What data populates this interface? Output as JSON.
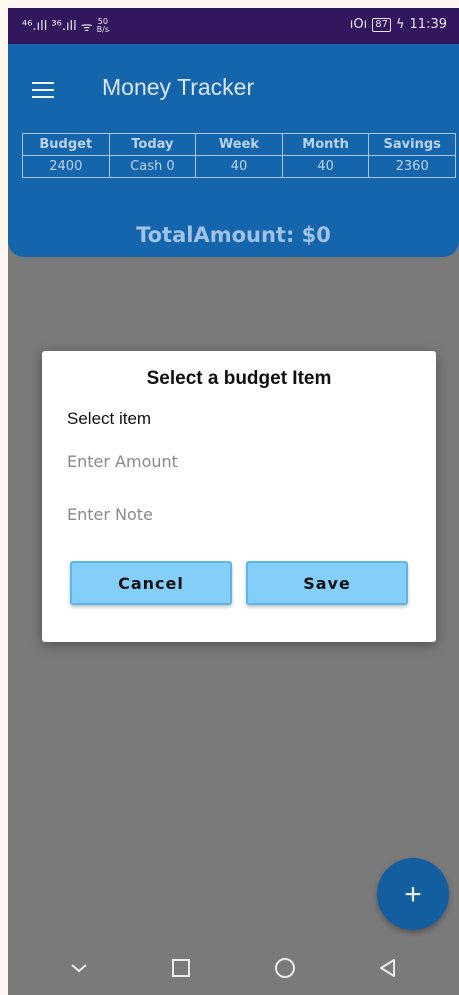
{
  "status_bar": {
    "signal_1": "⁴⁶.ıll",
    "signal_2": "³⁶.ıll",
    "wifi": "ᯤ",
    "speed_value": "50",
    "speed_unit": "B/s",
    "vibrate": "ıO͏ı",
    "battery": "87",
    "charging": "ϟ",
    "time": "11:39"
  },
  "app_bar": {
    "title": "Money Tracker",
    "stats_headers": [
      "Budget",
      "Today",
      "Week",
      "Month",
      "Savings"
    ],
    "stats_values": [
      "2400",
      "Cash 0",
      "40",
      "40",
      "2360"
    ],
    "total_amount": "TotalAmount: $0"
  },
  "dialog": {
    "title": "Select a budget Item",
    "select_label": "Select item",
    "amount_placeholder": "Enter Amount",
    "note_placeholder": "Enter Note",
    "cancel_label": "Cancel",
    "save_label": "Save"
  },
  "fab": {
    "label": "+"
  },
  "colors": {
    "status_bar": "#33175e",
    "app_bar": "#1565ad",
    "button": "#84cff9",
    "fab": "#125e9f"
  },
  "icons": [
    "menu-icon",
    "back-icon",
    "home-icon",
    "recents-icon",
    "collapse-icon"
  ]
}
